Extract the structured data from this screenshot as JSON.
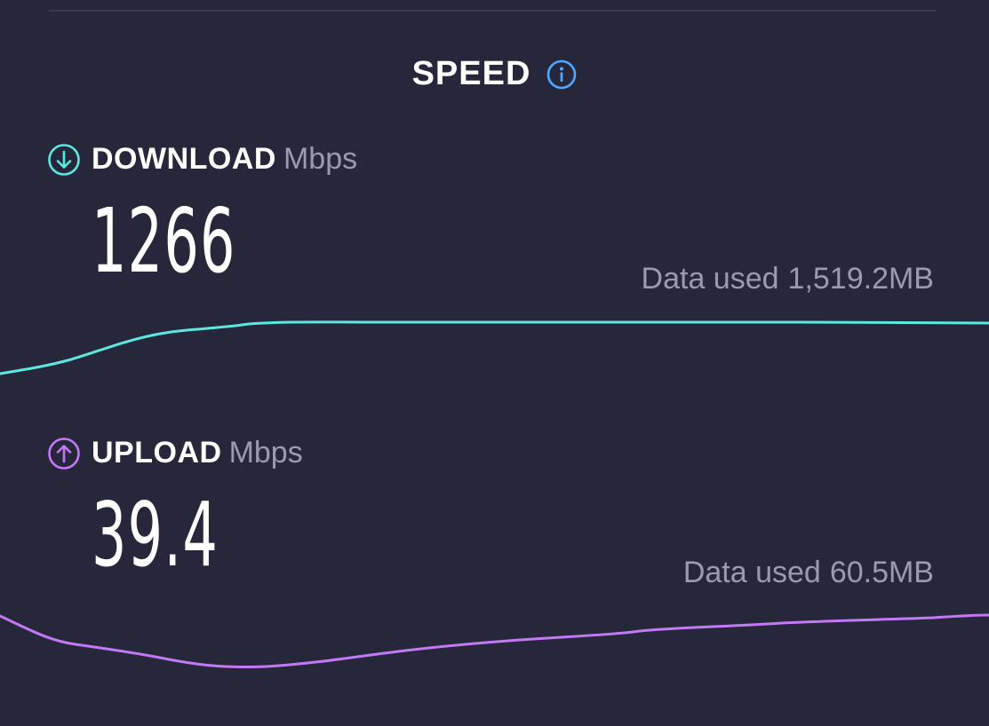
{
  "section": {
    "title": "SPEED",
    "info_icon": "info-icon"
  },
  "download": {
    "label": "DOWNLOAD",
    "unit": "Mbps",
    "value": "1266",
    "data_used_label": "Data used",
    "data_used_value": "1,519.2MB",
    "icon": "arrow-down-circle-icon",
    "color": "#5ce8e0"
  },
  "upload": {
    "label": "UPLOAD",
    "unit": "Mbps",
    "value": "39.4",
    "data_used_label": "Data used",
    "data_used_value": "60.5MB",
    "icon": "arrow-up-circle-icon",
    "color": "#c379f5"
  },
  "colors": {
    "background": "#26273b",
    "info_accent": "#4fa8ff",
    "muted_text": "#9a9bb0"
  }
}
